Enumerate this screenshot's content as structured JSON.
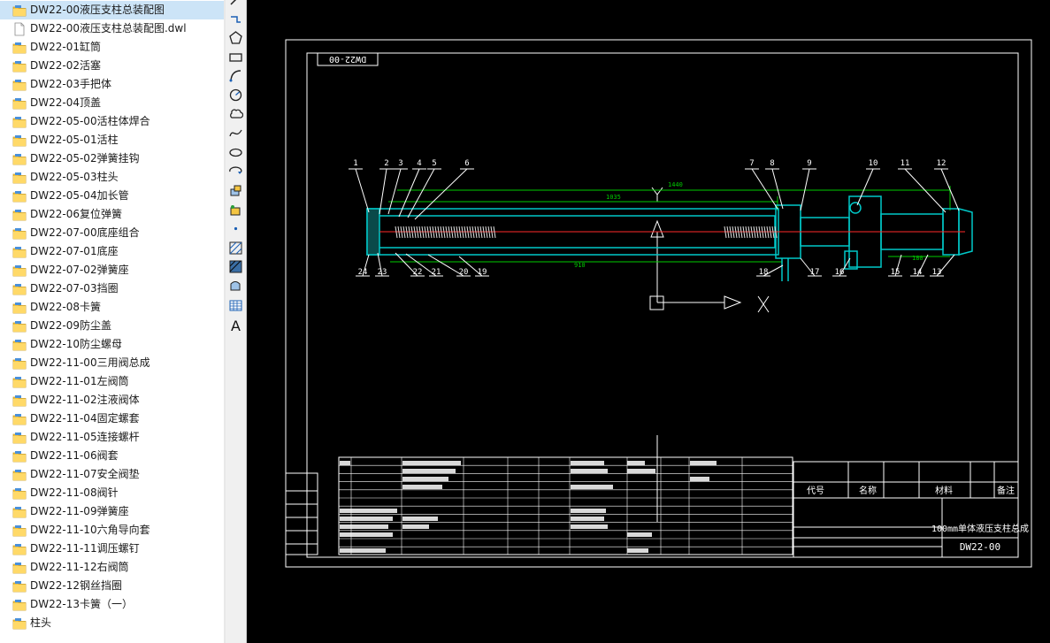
{
  "file_panel": {
    "items": [
      {
        "label": "DW22-00液压支柱总装配图",
        "type": "folder",
        "selected": true
      },
      {
        "label": "DW22-00液压支柱总装配图.dwl",
        "type": "file",
        "selected": false
      },
      {
        "label": "DW22-01缸筒",
        "type": "folder",
        "selected": false
      },
      {
        "label": "DW22-02活塞",
        "type": "folder",
        "selected": false
      },
      {
        "label": "DW22-03手把体",
        "type": "folder",
        "selected": false
      },
      {
        "label": "DW22-04顶盖",
        "type": "folder",
        "selected": false
      },
      {
        "label": "DW22-05-00活柱体焊合",
        "type": "folder",
        "selected": false
      },
      {
        "label": "DW22-05-01活柱",
        "type": "folder",
        "selected": false
      },
      {
        "label": "DW22-05-02弹簧挂钩",
        "type": "folder",
        "selected": false
      },
      {
        "label": "DW22-05-03柱头",
        "type": "folder",
        "selected": false
      },
      {
        "label": "DW22-05-04加长管",
        "type": "folder",
        "selected": false
      },
      {
        "label": "DW22-06复位弹簧",
        "type": "folder",
        "selected": false
      },
      {
        "label": "DW22-07-00底座组合",
        "type": "folder",
        "selected": false
      },
      {
        "label": "DW22-07-01底座",
        "type": "folder",
        "selected": false
      },
      {
        "label": "DW22-07-02弹簧座",
        "type": "folder",
        "selected": false
      },
      {
        "label": "DW22-07-03挡圈",
        "type": "folder",
        "selected": false
      },
      {
        "label": "DW22-08卡簧",
        "type": "folder",
        "selected": false
      },
      {
        "label": "DW22-09防尘盖",
        "type": "folder",
        "selected": false
      },
      {
        "label": "DW22-10防尘螺母",
        "type": "folder",
        "selected": false
      },
      {
        "label": "DW22-11-00三用阀总成",
        "type": "folder",
        "selected": false
      },
      {
        "label": "DW22-11-01左阀筒",
        "type": "folder",
        "selected": false
      },
      {
        "label": "DW22-11-02注液阀体",
        "type": "folder",
        "selected": false
      },
      {
        "label": "DW22-11-04固定螺套",
        "type": "folder",
        "selected": false
      },
      {
        "label": "DW22-11-05连接螺杆",
        "type": "folder",
        "selected": false
      },
      {
        "label": "DW22-11-06阀套",
        "type": "folder",
        "selected": false
      },
      {
        "label": "DW22-11-07安全阀垫",
        "type": "folder",
        "selected": false
      },
      {
        "label": "DW22-11-08阀针",
        "type": "folder",
        "selected": false
      },
      {
        "label": "DW22-11-09弹簧座",
        "type": "folder",
        "selected": false
      },
      {
        "label": "DW22-11-10六角导向套",
        "type": "folder",
        "selected": false
      },
      {
        "label": "DW22-11-11调压螺钉",
        "type": "folder",
        "selected": false
      },
      {
        "label": "DW22-11-12右阀筒",
        "type": "folder",
        "selected": false
      },
      {
        "label": "DW22-12钢丝挡圈",
        "type": "folder",
        "selected": false
      },
      {
        "label": "DW22-13卡簧（一）",
        "type": "folder",
        "selected": false
      },
      {
        "label": "柱头",
        "type": "folder",
        "selected": false
      }
    ]
  },
  "toolbar": {
    "tools": [
      {
        "name": "line-icon"
      },
      {
        "name": "polyline-icon"
      },
      {
        "name": "polygon-icon"
      },
      {
        "name": "rectangle-icon"
      },
      {
        "name": "arc-icon"
      },
      {
        "name": "circle-icon"
      },
      {
        "name": "revision-cloud-icon"
      },
      {
        "name": "spline-icon"
      },
      {
        "name": "ellipse-icon"
      },
      {
        "name": "ellipse-arc-icon"
      },
      {
        "name": "insert-block-icon"
      },
      {
        "name": "make-block-icon"
      },
      {
        "name": "point-icon"
      },
      {
        "name": "hatch-icon"
      },
      {
        "name": "gradient-icon"
      },
      {
        "name": "region-icon"
      },
      {
        "name": "table-icon"
      },
      {
        "name": "multiline-text-icon",
        "glyph": "A"
      }
    ]
  },
  "drawing": {
    "top_label": "DW22-00",
    "title_block": {
      "product_name": "100mm单体液压支柱总成",
      "drawing_number": "DW22-00",
      "columns": [
        "代号",
        "名称",
        "材料",
        "备注"
      ]
    },
    "dimensions": [
      "1440",
      "1035",
      "910",
      "180"
    ],
    "balloons": [
      "1",
      "2",
      "3",
      "4",
      "5",
      "6",
      "7",
      "8",
      "9",
      "10",
      "11",
      "12",
      "13",
      "14",
      "15",
      "16",
      "17",
      "18",
      "19",
      "20",
      "21",
      "22",
      "23",
      "24"
    ],
    "ucs": {
      "x_label": "X",
      "y_label": "Y"
    },
    "colors": {
      "background": "#000000",
      "frame": "#ffffff",
      "outline": "#00c8c8",
      "dimension": "#00cc00",
      "centerline": "#ff2a2a",
      "spring": "#e0e0e0"
    }
  }
}
